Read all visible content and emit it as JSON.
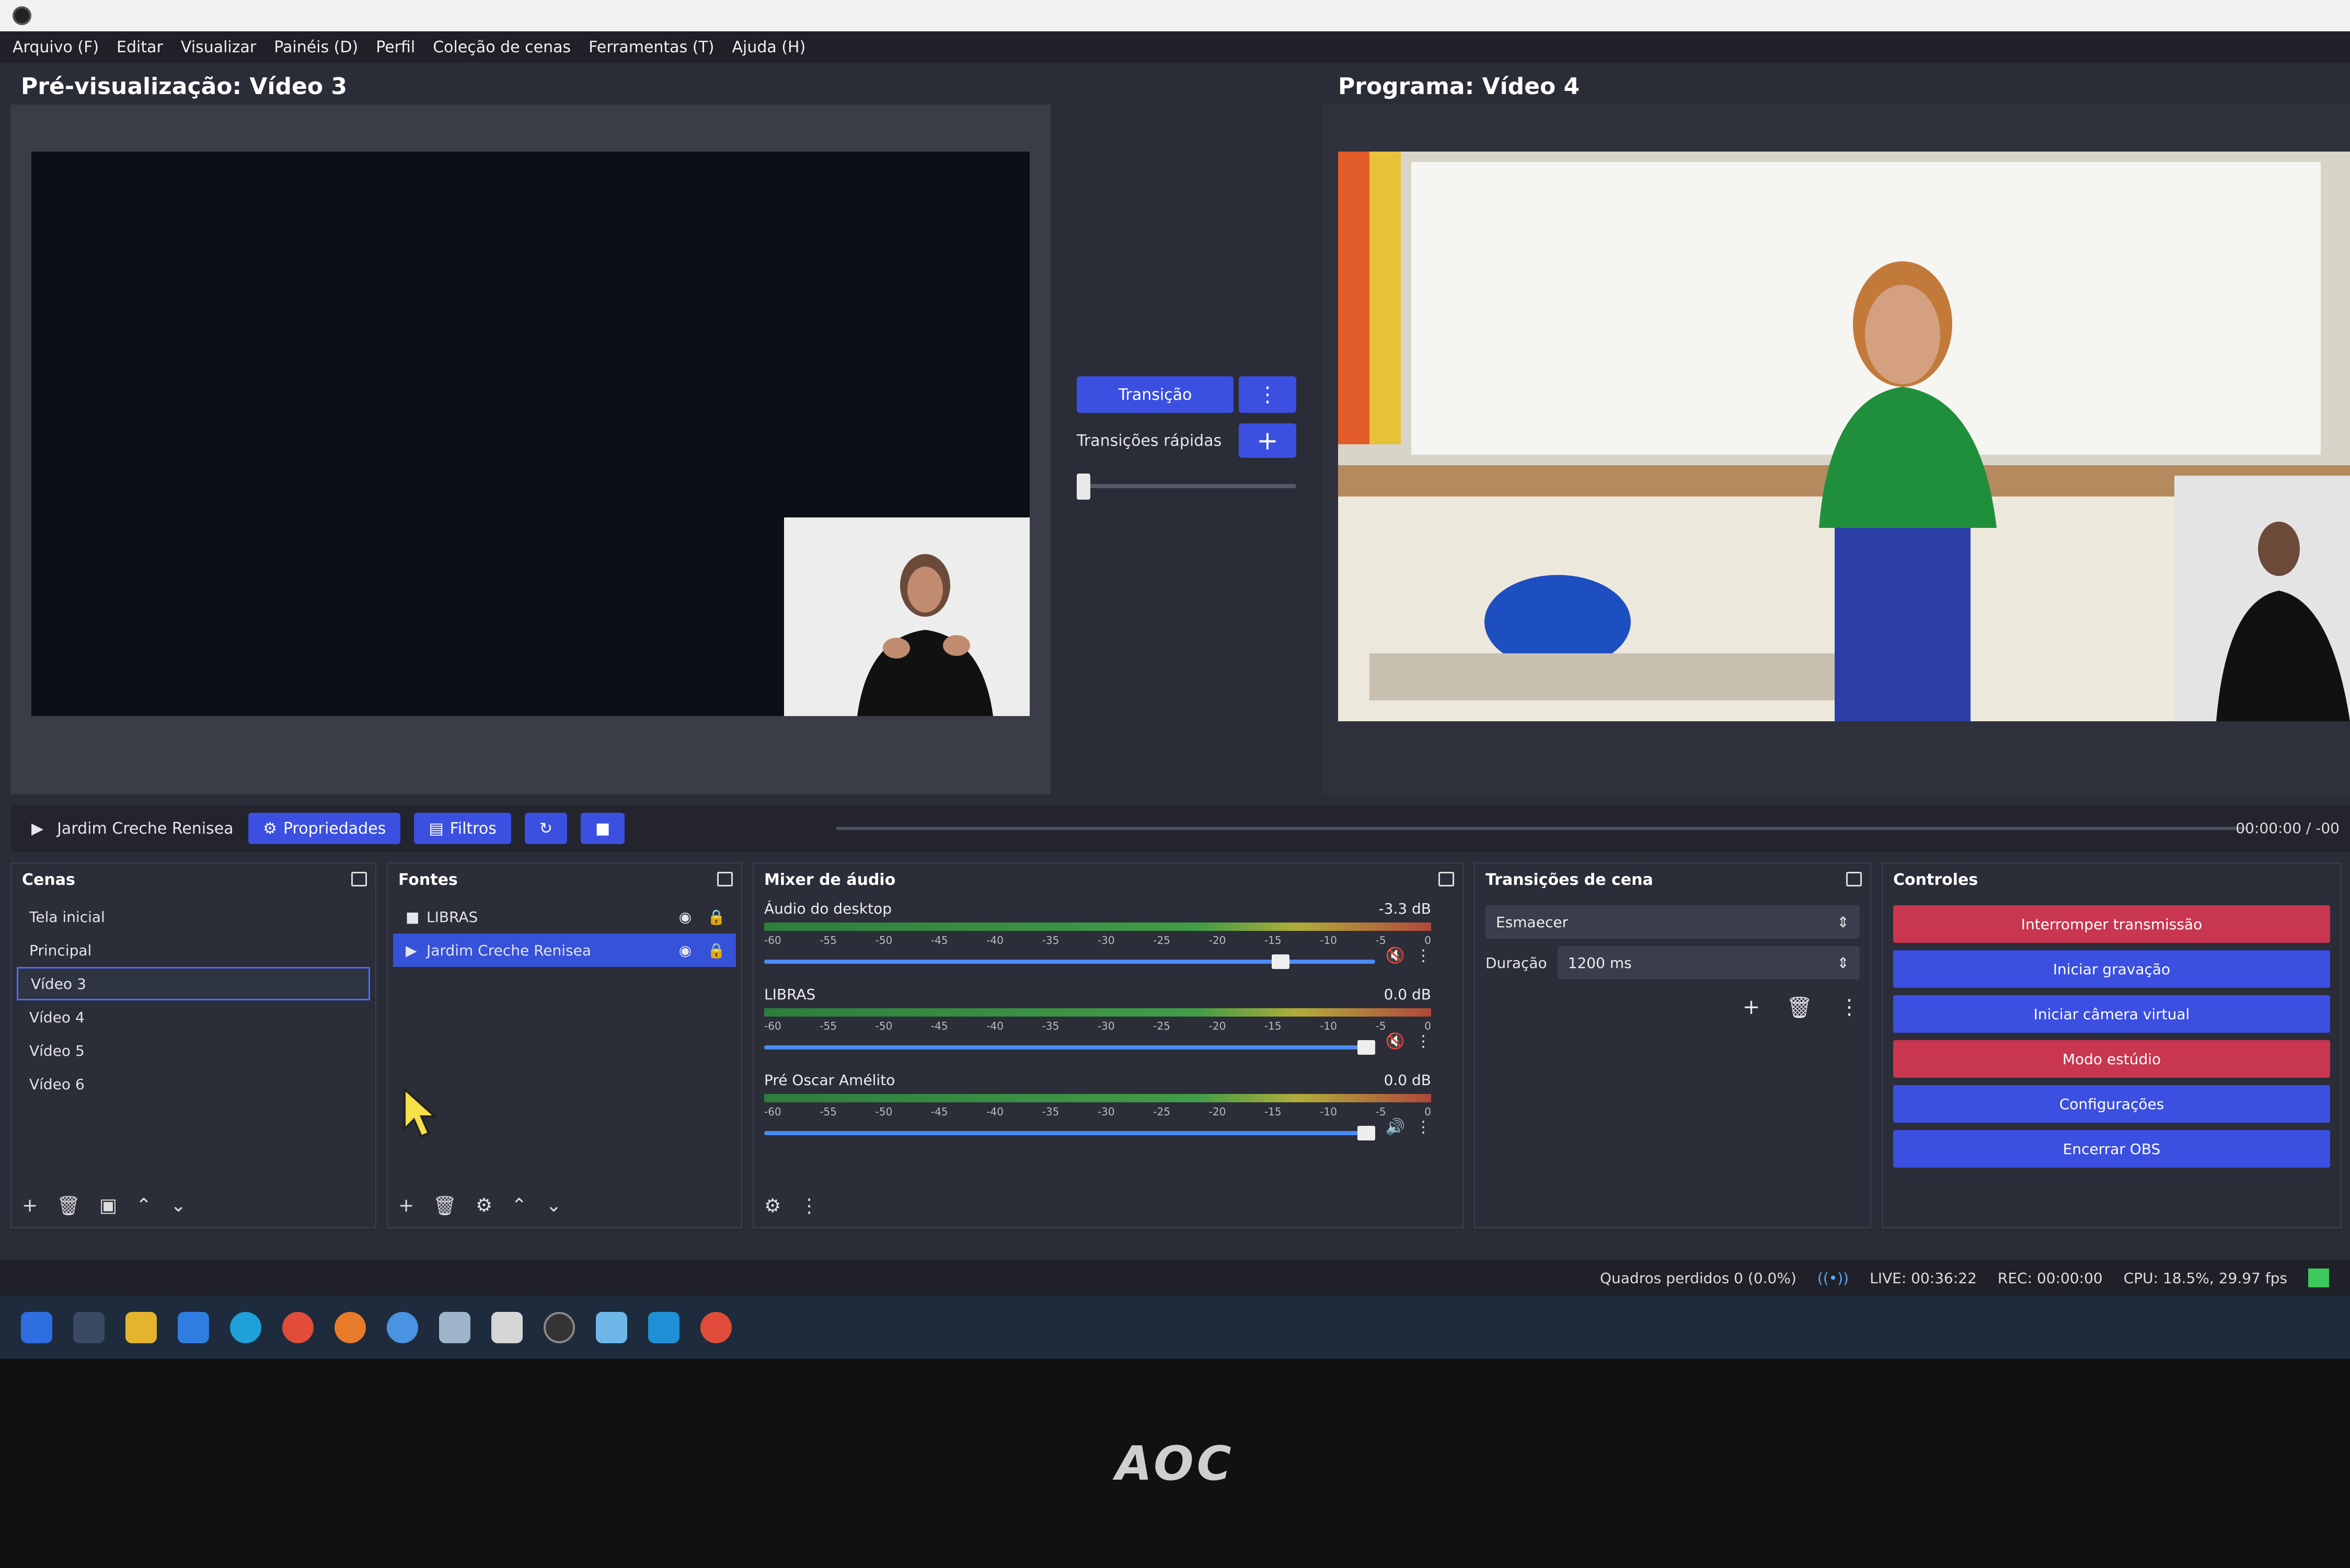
{
  "menu": [
    "Arquivo (F)",
    "Editar",
    "Visualizar",
    "Painéis (D)",
    "Perfil",
    "Coleção de cenas",
    "Ferramentas (T)",
    "Ajuda (H)"
  ],
  "preview": {
    "title": "Pré-visualização: Vídeo 3"
  },
  "program": {
    "title": "Programa: Vídeo 4"
  },
  "transition": {
    "button": "Transição",
    "quick_label": "Transições rápidas"
  },
  "source_bar": {
    "current_source": "Jardim Creche Renisea",
    "properties": "Propriedades",
    "filters": "Filtros",
    "time": "00:00:00 / -00"
  },
  "scenes": {
    "title": "Cenas",
    "items": [
      "Tela inicial",
      "Principal",
      "Vídeo 3",
      "Vídeo 4",
      "Vídeo 5",
      "Vídeo 6"
    ],
    "selected_index": 2
  },
  "sources": {
    "title": "Fontes",
    "items": [
      "LIBRAS",
      "Jardim Creche Renisea"
    ]
  },
  "mixer": {
    "title": "Mixer de áudio",
    "channels": [
      {
        "name": "Áudio do desktop",
        "db": "-3.3 dB",
        "volume": 0.86,
        "muted": true
      },
      {
        "name": "LIBRAS",
        "db": "0.0 dB",
        "volume": 1.0,
        "muted": true
      },
      {
        "name": "Pré Oscar Amélito",
        "db": "0.0 dB",
        "volume": 1.0,
        "muted": false
      }
    ],
    "scale": [
      "-60",
      "-55",
      "-50",
      "-45",
      "-40",
      "-35",
      "-30",
      "-25",
      "-20",
      "-15",
      "-10",
      "-5",
      "0"
    ]
  },
  "scene_transitions": {
    "title": "Transições de cena",
    "type": "Esmaecer",
    "duration_label": "Duração",
    "duration_value": "1200 ms"
  },
  "controls": {
    "title": "Controles",
    "buttons": [
      {
        "label": "Interromper transmissão",
        "color": "#c8364f"
      },
      {
        "label": "Iniciar gravação",
        "color": "#3b4fe0"
      },
      {
        "label": "Iniciar câmera virtual",
        "color": "#3b4fe0"
      },
      {
        "label": "Modo estúdio",
        "color": "#c8364f"
      },
      {
        "label": "Configurações",
        "color": "#3b4fe0"
      },
      {
        "label": "Encerrar OBS",
        "color": "#3b4fe0"
      }
    ]
  },
  "status": {
    "dropped": "Quadros perdidos 0 (0.0%)",
    "live": "LIVE: 00:36:22",
    "rec": "REC: 00:00:00",
    "cpu": "CPU: 18.5%, 29.97 fps"
  },
  "monitor_brand": "AOC",
  "colors": {
    "accent": "#3b4fe0",
    "danger": "#c8364f",
    "panel": "#2b2d38"
  }
}
